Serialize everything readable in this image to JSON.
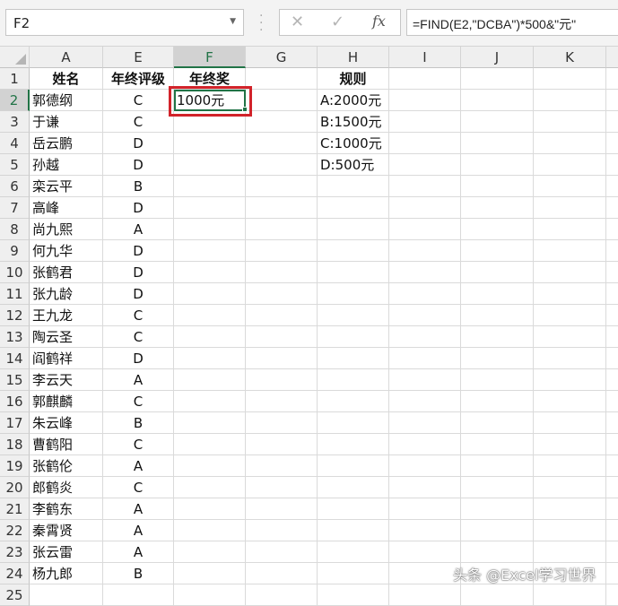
{
  "name_box": "F2",
  "formula": "=FIND(E2,\"DCBA\")*500&\"元\"",
  "formula_icons": {
    "cancel": "✕",
    "enter": "✓",
    "fx": "fx"
  },
  "columns": [
    "A",
    "E",
    "F",
    "G",
    "H",
    "I",
    "J",
    "K"
  ],
  "selected_column": "F",
  "selected_row": "2",
  "headers": {
    "A": "姓名",
    "E": "年终评级",
    "F": "年终奖",
    "H": "规则"
  },
  "rows": [
    {
      "n": "2",
      "name": "郭德纲",
      "grade": "C",
      "bonus": "1000元",
      "rule": "A:2000元"
    },
    {
      "n": "3",
      "name": "于谦",
      "grade": "C",
      "rule": "B:1500元"
    },
    {
      "n": "4",
      "name": "岳云鹏",
      "grade": "D",
      "rule": "C:1000元"
    },
    {
      "n": "5",
      "name": "孙越",
      "grade": "D",
      "rule": "D:500元"
    },
    {
      "n": "6",
      "name": "栾云平",
      "grade": "B"
    },
    {
      "n": "7",
      "name": "高峰",
      "grade": "D"
    },
    {
      "n": "8",
      "name": "尚九熙",
      "grade": "A"
    },
    {
      "n": "9",
      "name": "何九华",
      "grade": "D"
    },
    {
      "n": "10",
      "name": "张鹤君",
      "grade": "D"
    },
    {
      "n": "11",
      "name": "张九龄",
      "grade": "D"
    },
    {
      "n": "12",
      "name": "王九龙",
      "grade": "C"
    },
    {
      "n": "13",
      "name": "陶云圣",
      "grade": "C"
    },
    {
      "n": "14",
      "name": "阎鹤祥",
      "grade": "D"
    },
    {
      "n": "15",
      "name": "李云天",
      "grade": "A"
    },
    {
      "n": "16",
      "name": "郭麒麟",
      "grade": "C"
    },
    {
      "n": "17",
      "name": "朱云峰",
      "grade": "B"
    },
    {
      "n": "18",
      "name": "曹鹤阳",
      "grade": "C"
    },
    {
      "n": "19",
      "name": "张鹤伦",
      "grade": "A"
    },
    {
      "n": "20",
      "name": "郎鹤炎",
      "grade": "C"
    },
    {
      "n": "21",
      "name": "李鹤东",
      "grade": "A"
    },
    {
      "n": "22",
      "name": "秦霄贤",
      "grade": "A"
    },
    {
      "n": "23",
      "name": "张云雷",
      "grade": "A"
    },
    {
      "n": "24",
      "name": "杨九郎",
      "grade": "B"
    }
  ],
  "watermark": "头条 @Excel学习世界"
}
